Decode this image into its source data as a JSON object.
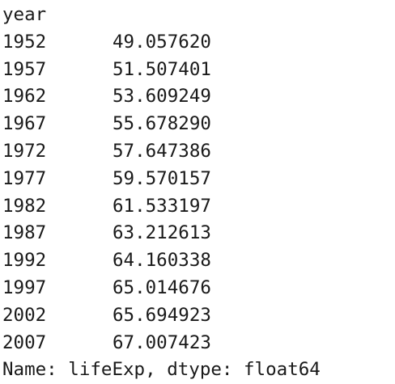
{
  "series_output": {
    "index_name": "year",
    "rows": [
      {
        "year": "1952",
        "value": "49.057620"
      },
      {
        "year": "1957",
        "value": "51.507401"
      },
      {
        "year": "1962",
        "value": "53.609249"
      },
      {
        "year": "1967",
        "value": "55.678290"
      },
      {
        "year": "1972",
        "value": "57.647386"
      },
      {
        "year": "1977",
        "value": "59.570157"
      },
      {
        "year": "1982",
        "value": "61.533197"
      },
      {
        "year": "1987",
        "value": "63.212613"
      },
      {
        "year": "1992",
        "value": "64.160338"
      },
      {
        "year": "1997",
        "value": "65.014676"
      },
      {
        "year": "2002",
        "value": "65.694923"
      },
      {
        "year": "2007",
        "value": "67.007423"
      }
    ],
    "footer": "Name: lifeExp, dtype: float64"
  }
}
